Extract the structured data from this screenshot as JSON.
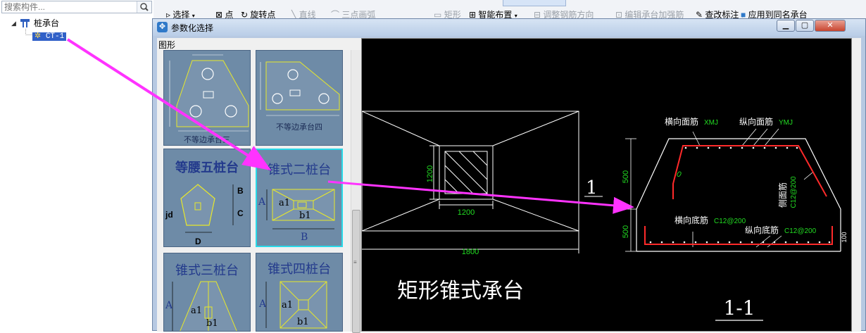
{
  "search": {
    "placeholder": "搜索构件..."
  },
  "tree": {
    "root_label": "桩承台",
    "child_label": "CT-1"
  },
  "toolbar": {
    "select": "选择",
    "point": "点",
    "rotate_point": "旋转点",
    "line": "直线",
    "three_point_arc": "三点画弧",
    "rectangle": "矩形",
    "smart_place": "智能布置",
    "adjust_rebar_dir": "调整钢筋方向",
    "edit_cap_rebar": "编辑承台加强筋",
    "check_label": "查改标注",
    "apply_same_name": "应用到同名承台"
  },
  "dialog": {
    "title": "参数化选择",
    "group_label": "图形",
    "thumbnails": [
      {
        "caption": "不等边承台三"
      },
      {
        "caption": "不等边承台四"
      },
      {
        "title": "等腰五桩台",
        "labels": [
          "B",
          "C",
          "jd",
          "D"
        ]
      },
      {
        "title": "锥式二桩台",
        "labels": [
          "A",
          "a1",
          "b1",
          "B"
        ]
      },
      {
        "title": "锥式三桩台",
        "labels": [
          "A",
          "a1",
          "b1"
        ]
      },
      {
        "title": "锥式四桩台",
        "labels": [
          "A",
          "a1",
          "b1"
        ]
      }
    ],
    "preview": {
      "dim_1200_v": "1200",
      "dim_1200_h": "1200",
      "dim_1800": "1800",
      "section_mark": "1",
      "main_title": "矩形锥式承台",
      "section_title": "1-1",
      "dim_500_top": "500",
      "dim_500_bottom": "500",
      "dim_zero": "0",
      "label_top_transverse": "横向面筋",
      "label_top_transverse_code": "XMJ",
      "label_top_longitudinal": "纵向面筋",
      "label_top_longitudinal_code": "YMJ",
      "label_side": "侧面筋",
      "label_side_spec": "C12@200",
      "label_bottom_transverse": "横向底筋",
      "label_bottom_transverse_spec": "C12@200",
      "label_bottom_longitudinal": "纵向底筋",
      "label_bottom_longitudinal_spec": "C12@200",
      "edge_dim": "100"
    }
  },
  "colors": {
    "annotation_arrow": "#ff33ff",
    "cad_background": "#000000",
    "cad_green": "#22dd22",
    "cad_red": "#ff2a2a",
    "selection_border": "#2ad9e8"
  }
}
